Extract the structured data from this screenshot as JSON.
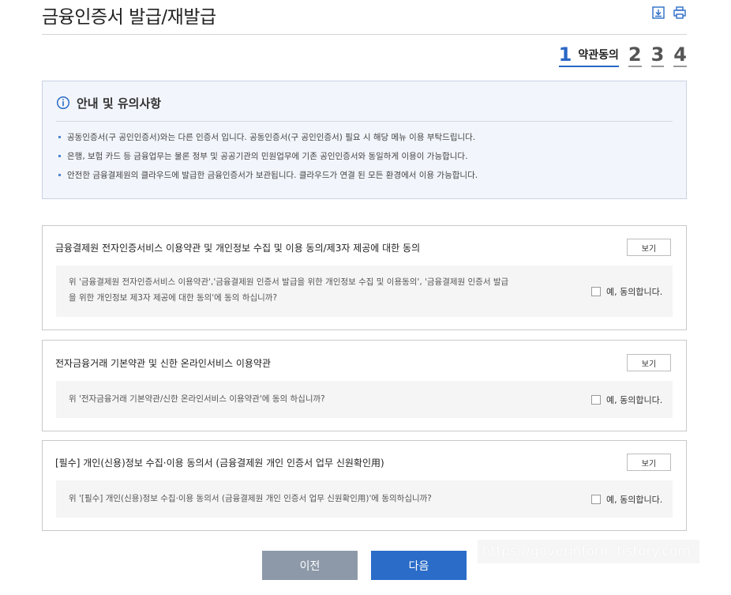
{
  "page_title": "금융인증서 발급/재발급",
  "steps": [
    {
      "num": "1",
      "label": "약관동의"
    },
    {
      "num": "2"
    },
    {
      "num": "3"
    },
    {
      "num": "4"
    }
  ],
  "notice": {
    "title": "안내 및 유의사항",
    "items": [
      "공동인증서(구 공인인증서)와는 다른 인증서 입니다. 공동인증서(구 공인인증서) 필요 시 해당 메뉴 이용 부탁드립니다.",
      "은행, 보험 카드 등 금융업무는 물론 정부 및 공공기관의 민원업무에 기존 공인인증서와 동일하게 이용이 가능합니다.",
      "안전한 금융결제원의 클라우드에 발급한 금융인증서가 보관됩니다. 클라우드가 연결 된 모든 환경에서 이용 가능합니다."
    ]
  },
  "terms": [
    {
      "title": "금융결제원 전자인증서비스 이용약관 및 개인정보 수집 및 이용 동의/제3자 제공에 대한 동의",
      "view_label": "보기",
      "question_lines": [
        "위 '금융결제원 전자인증서비스 이용약관','금융결제원 인증서 발급을 위한 개인정보 수집 및 이용동의', '금융결제원 인증서 발급",
        "을 위한 개인정보 제3자 제공에 대한 동의'에 동의 하십니까?"
      ],
      "agree_label": "예, 동의합니다."
    },
    {
      "title": "전자금융거래 기본약관 및 신한 온라인서비스 이용약관",
      "view_label": "보기",
      "question_lines": [
        "위 '전자금융거래 기본약관/신한 온라인서비스 이용약관'에 동의 하십니까?"
      ],
      "agree_label": "예, 동의합니다."
    },
    {
      "title": "[필수] 개인(신용)정보 수집·이용 동의서 (금융결제원 개인 인증서 업무 신원확인用)",
      "view_label": "보기",
      "question_lines": [
        "위 '[필수] 개인(신용)정보 수집·이용 동의서 (금융결제원 개인 인증서 업무 신원확인用)'에 동의하십니까?"
      ],
      "agree_label": "예, 동의합니다."
    }
  ],
  "buttons": {
    "prev": "이전",
    "next": "다음"
  },
  "watermark": "https://goverinform.tistory.com",
  "colors": {
    "accent": "#2a6cc8",
    "prev_button": "#8d99a8",
    "notice_bg": "#f2f5fb"
  },
  "icons": [
    "download-icon",
    "print-icon",
    "info-icon",
    "checkbox"
  ]
}
